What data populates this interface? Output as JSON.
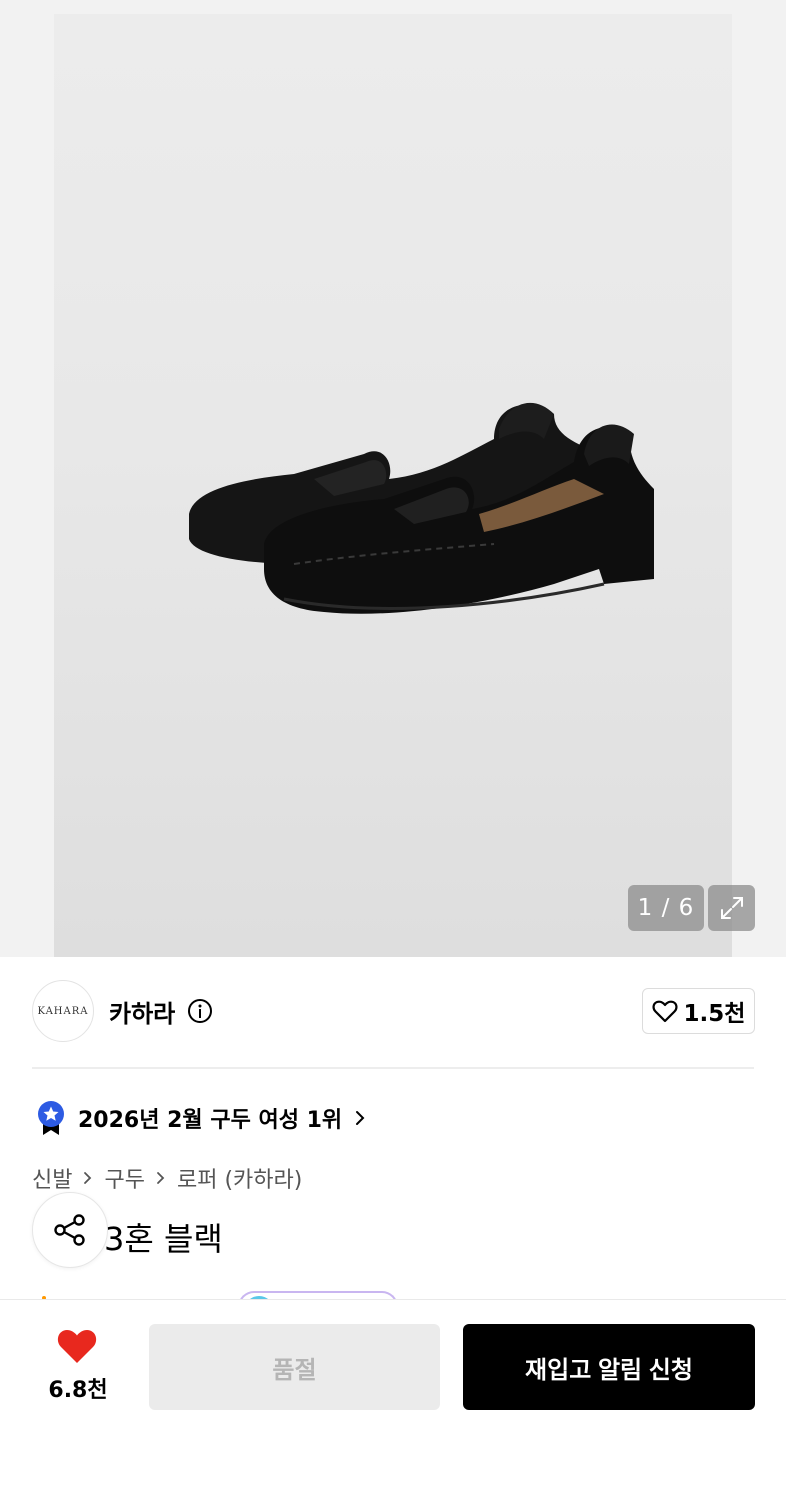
{
  "gallery": {
    "counter": "1 / 6",
    "image_alt": "black leather penny loafers"
  },
  "brand": {
    "logo_text": "KAHARA",
    "name": "카하라",
    "like_count": "1.5천"
  },
  "ranking": {
    "text": "2026년 2월 구두 여성 1위"
  },
  "breadcrumb": {
    "items": [
      "신발",
      "구두",
      "로퍼 (카하라)"
    ]
  },
  "product": {
    "title_visible": "3혼 블랙"
  },
  "bottom_bar": {
    "favorite_count": "6.8천",
    "soldout_label": "품절",
    "restock_label": "재입고 알림 신청"
  },
  "colors": {
    "heart": "#e8281e",
    "rank_badge": "#2d5be3",
    "primary_button": "#000000",
    "disabled_button": "#ebebeb"
  },
  "icons": [
    "expand-icon",
    "info-icon",
    "heart-outline-icon",
    "rank-badge-icon",
    "chevron-right-icon",
    "share-icon",
    "heart-filled-icon"
  ]
}
